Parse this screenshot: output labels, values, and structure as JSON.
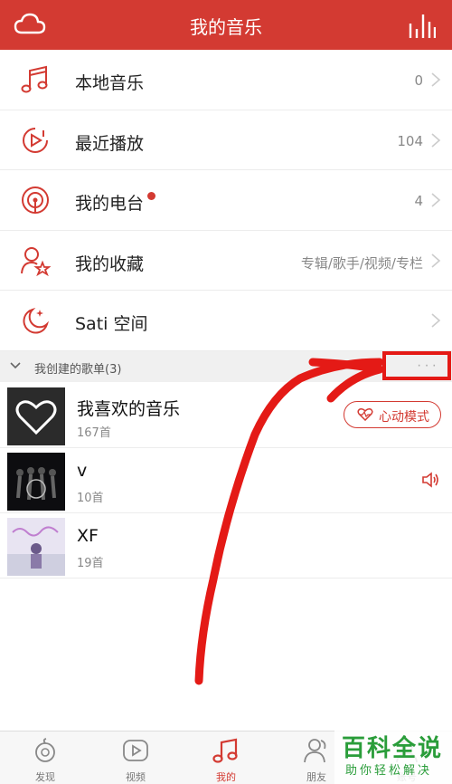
{
  "header": {
    "title": "我的音乐",
    "left_icon": "cloud-icon",
    "right_icon": "equalizer-icon",
    "background": "#d33a32"
  },
  "menu": [
    {
      "label": "本地音乐",
      "value": "0",
      "icon": "music-note-icon"
    },
    {
      "label": "最近播放",
      "value": "104",
      "icon": "recent-play-icon"
    },
    {
      "label": "我的电台",
      "value": "4",
      "icon": "radio-icon",
      "badge": true
    },
    {
      "label": "我的收藏",
      "value": "专辑/歌手/视频/专栏",
      "icon": "user-star-icon"
    },
    {
      "label": "Sati 空间",
      "value": "",
      "icon": "moon-icon"
    }
  ],
  "playlists_section": {
    "title": "我创建的歌单(3)",
    "more_label": "···"
  },
  "playlists": [
    {
      "name": "我喜欢的音乐",
      "count": "167首",
      "action": "心动模式"
    },
    {
      "name": "v",
      "count": "10首",
      "playing": true
    },
    {
      "name": "XF",
      "count": "19首"
    }
  ],
  "tabs": [
    {
      "label": "发现",
      "icon": "discover-icon"
    },
    {
      "label": "视频",
      "icon": "video-icon"
    },
    {
      "label": "我的",
      "icon": "my-music-icon",
      "active": true
    },
    {
      "label": "朋友",
      "icon": "friends-icon"
    },
    {
      "label": "账号",
      "icon": "account-icon"
    }
  ],
  "watermark": {
    "main": "百科全说",
    "sub": "助你轻松解决"
  },
  "colors": {
    "accent": "#d33a32",
    "annotation": "#e41a16",
    "watermark": "#2a9d3a"
  }
}
